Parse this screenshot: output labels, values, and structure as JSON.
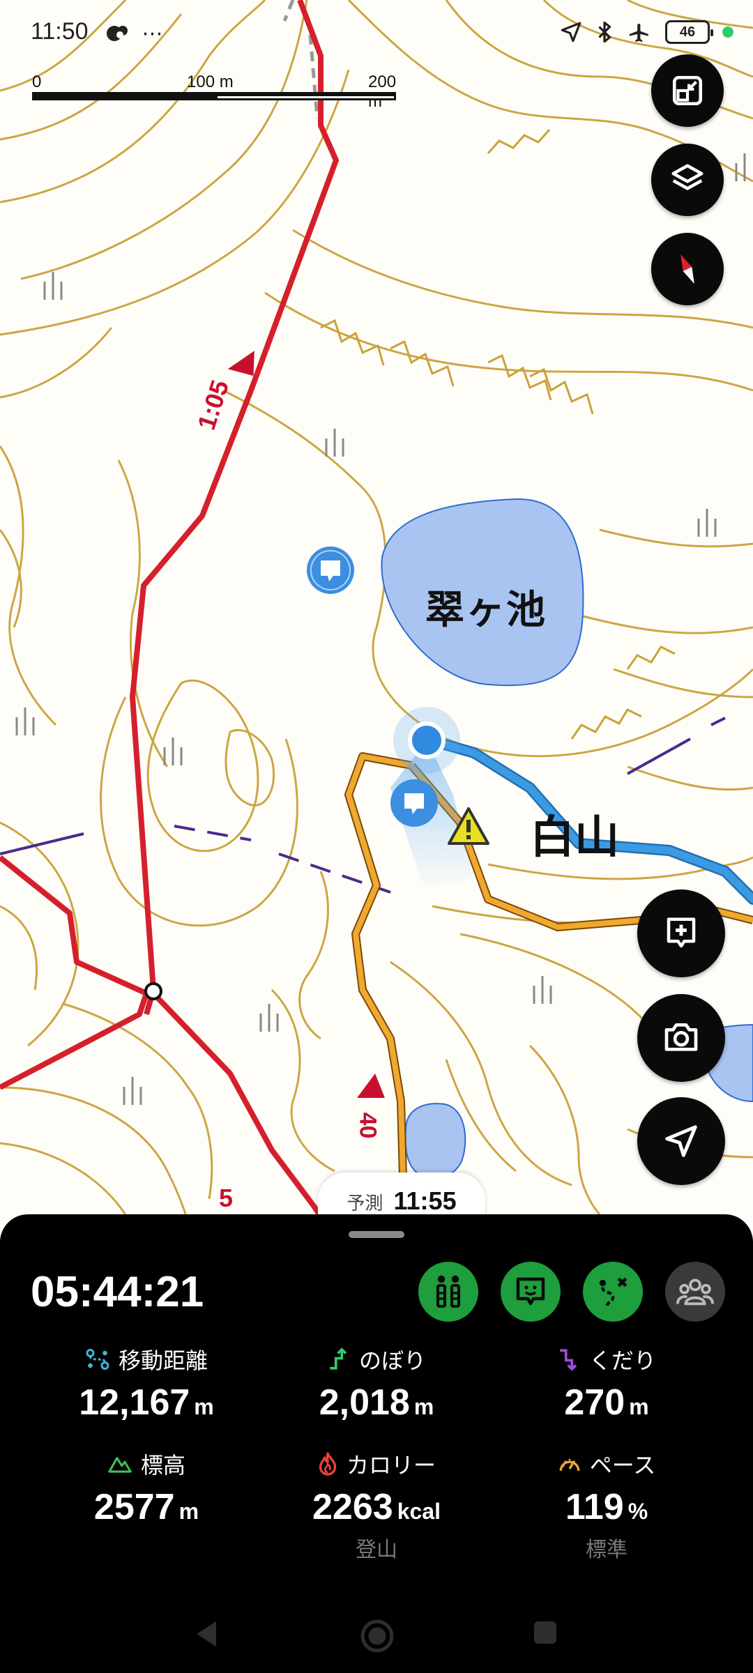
{
  "status_bar": {
    "time": "11:50",
    "left_icons": [
      "weather-icon",
      "more-dots-icon"
    ],
    "right_icons": [
      "location-arrow-icon",
      "bluetooth-icon",
      "airplane-icon"
    ],
    "battery": "46"
  },
  "map": {
    "scale": {
      "start": "0",
      "mid": "100 m",
      "end": "200 m"
    },
    "pond_label": "翠ヶ池",
    "peak_label": "白山",
    "trail_time_1": "1:05",
    "trail_time_2": "40",
    "trail_marker": "5",
    "eta": {
      "label": "予測",
      "value": "11:55"
    }
  },
  "colors": {
    "contour": "#c9a23a",
    "trail_red": "#d5202c",
    "trail_orange": "#f0a830",
    "route_blue": "#3b9ae1",
    "water": "#a9c4f0",
    "accent_green": "#1e9e3c"
  },
  "panel": {
    "elapsed": "05:44:21",
    "stats": [
      {
        "label": "移動距離",
        "value": "12,167",
        "unit": "m",
        "icon": "distance-icon"
      },
      {
        "label": "のぼり",
        "value": "2,018",
        "unit": "m",
        "icon": "ascent-icon"
      },
      {
        "label": "くだり",
        "value": "270",
        "unit": "m",
        "icon": "descent-icon"
      },
      {
        "label": "標高",
        "value": "2577",
        "unit": "m",
        "icon": "mountain-icon"
      },
      {
        "label": "カロリー",
        "value": "2263",
        "unit": "kcal",
        "icon": "flame-icon",
        "sub": "登山"
      },
      {
        "label": "ペース",
        "value": "119",
        "unit": "%",
        "icon": "speedometer-icon",
        "sub": "標準"
      }
    ]
  }
}
